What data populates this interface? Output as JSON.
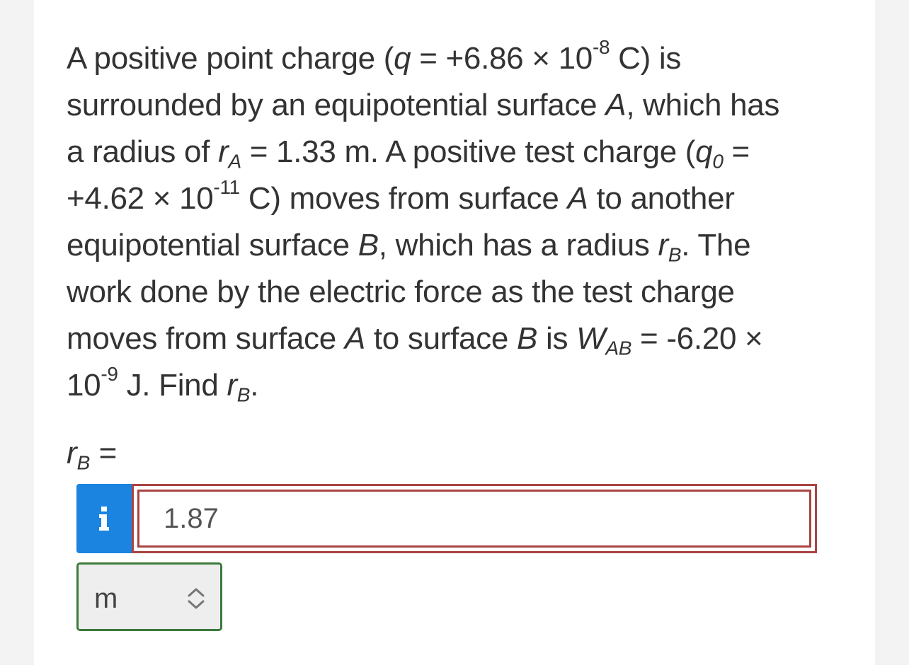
{
  "question": {
    "line1": {
      "a": "A positive point charge (",
      "q": "q",
      "b": " = +6.86 × 10",
      "exp": "-8",
      "c": " C) is"
    },
    "line2": {
      "a": "surrounded by an equipotential surface ",
      "A": "A",
      "b": ", which has"
    },
    "line3": {
      "a": "a radius of ",
      "r": "r",
      "sub": "A",
      "b": " = 1.33 m. A positive test charge (",
      "q": "q",
      "qsub": "0",
      "c": " ="
    },
    "line4": {
      "a": "+4.62 × 10",
      "exp": "-11",
      "b": " C) moves from surface ",
      "A": "A",
      "c": " to another"
    },
    "line5": {
      "a": "equipotential surface ",
      "B": "B",
      "b": ", which has a radius ",
      "r": "r",
      "sub": "B",
      "c": ". The"
    },
    "line6": {
      "a": "work done by the electric force as the test charge"
    },
    "line7": {
      "a": "moves from surface ",
      "A": "A",
      "b": " to surface ",
      "B": "B",
      "c": " is ",
      "W": "W",
      "sub": "AB",
      "d": " = -6.20 ×"
    },
    "line8": {
      "a": "10",
      "exp": "-9",
      "b": " J. Find ",
      "r": "r",
      "sub": "B",
      "c": "."
    }
  },
  "answer": {
    "label_var": "r",
    "label_sub": "B",
    "label_eq": " =",
    "value": "1.87",
    "info_icon": "info-icon",
    "input_status_color": "#a94442",
    "info_button_color": "#1a84e0"
  },
  "unit": {
    "selected": "m",
    "arrows_icon": "up-down-chevron-icon",
    "status_color": "#3c7a3c"
  }
}
